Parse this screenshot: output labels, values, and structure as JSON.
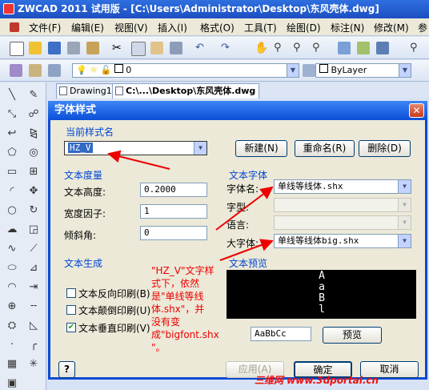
{
  "window": {
    "title": "ZWCAD 2011 试用版 - [C:\\Users\\Administrator\\Desktop\\东风壳体.dwg]"
  },
  "menu": [
    "文件(F)",
    "编辑(E)",
    "视图(V)",
    "插入(I)",
    "格式(O)",
    "工具(T)",
    "绘图(D)",
    "标注(N)",
    "修改(M)",
    "参"
  ],
  "layer_bar": {
    "layer_value": "0",
    "linetype_value": "ByLayer"
  },
  "doc_tabs": [
    "Drawing1",
    "C:\\...\\Desktop\\东风壳体.dwg"
  ],
  "dialog": {
    "title": "字体样式",
    "current_style": {
      "label": "当前样式名",
      "value": "HZ_V",
      "new_button": "新建(N)",
      "rename_button": "重命名(R)",
      "delete_button": "删除(D)"
    },
    "metrics": {
      "label": "文本度量",
      "height_label": "文本高度:",
      "height_value": "0.2000",
      "width_label": "宽度因子:",
      "width_value": "1",
      "oblique_label": "倾斜角:",
      "oblique_value": "0"
    },
    "font": {
      "label": "文本字体",
      "name_label": "字体名:",
      "name_value": "单线等线体.shx",
      "style_label": "字型:",
      "lang_label": "语言:",
      "bigfont_label": "大字体:",
      "bigfont_value": "单线等线体big.shx"
    },
    "generation": {
      "label": "文本生成",
      "backward": "文本反向印刷(B)",
      "upside_down": "文本颠倒印刷(U)",
      "vertical": "文本垂直印刷(V)",
      "vertical_checked": true
    },
    "preview": {
      "label": "文本预览",
      "vertical_text": [
        "A",
        "a",
        "B",
        "l"
      ],
      "sample_text": "AaBbCc",
      "preview_button": "预览"
    },
    "buttons": {
      "help": "?",
      "apply": "应用(A)",
      "ok": "确定",
      "cancel": "取消"
    }
  },
  "annotation": {
    "lines": [
      "\"HZ_V\"文字样",
      "式下，依然",
      "是\"单线等线",
      "体.shx\"，并",
      "没有变",
      "成\"bigfont.shx",
      "\"。"
    ]
  },
  "watermark": "三维网 www.3dportal.cn",
  "colors": {
    "accent": "#0046d5",
    "annotation": "#e00000",
    "title_blue": "#0b4fd8"
  }
}
